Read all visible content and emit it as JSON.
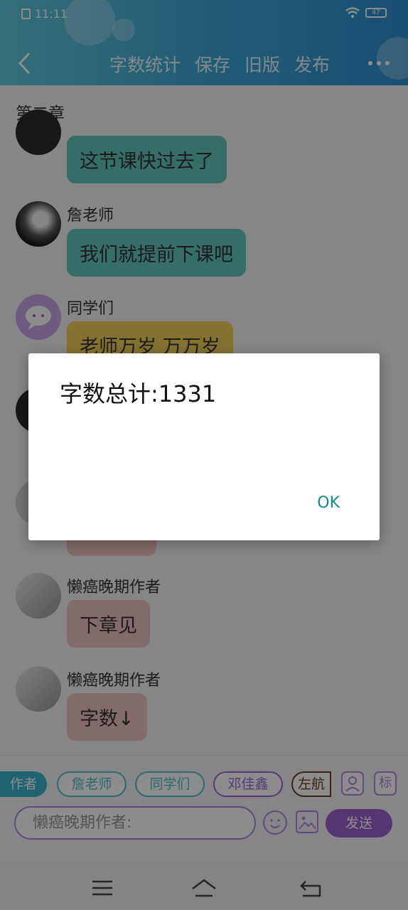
{
  "status_bar": {
    "time": "11:11",
    "battery": "47"
  },
  "header": {
    "menu": [
      "字数统计",
      "保存",
      "旧版",
      "发布"
    ]
  },
  "chapter_title": "第二章",
  "messages": [
    {
      "name": "",
      "text": "这节课快过去了",
      "color": "teal"
    },
    {
      "name": "詹老师",
      "text": "我们就提前下课吧",
      "color": "teal"
    },
    {
      "name": "同学们",
      "text": "老师万岁 万万岁",
      "color": "yellow"
    },
    {
      "name": "懒癌晚期作者",
      "text": "下章见",
      "color": "pink"
    },
    {
      "name": "懒癌晚期作者",
      "text": "字数↓",
      "color": "pink"
    }
  ],
  "role_chips": [
    "作者",
    "詹老师",
    "同学们",
    "邓佳鑫",
    "左航"
  ],
  "chip_icon_label": "标",
  "input": {
    "value": "懒癌晚期作者:"
  },
  "send_label": "发送",
  "dialog": {
    "message": "字数总计:1331",
    "ok_label": "OK"
  },
  "colors": {
    "header": "#3aa7d8",
    "teal_bubble": "#63c6bc",
    "yellow_bubble": "#f2cf5a",
    "pink_bubble": "#f1c3c4",
    "accent_purple": "#9b62d0",
    "ok_text": "#138a8a"
  }
}
